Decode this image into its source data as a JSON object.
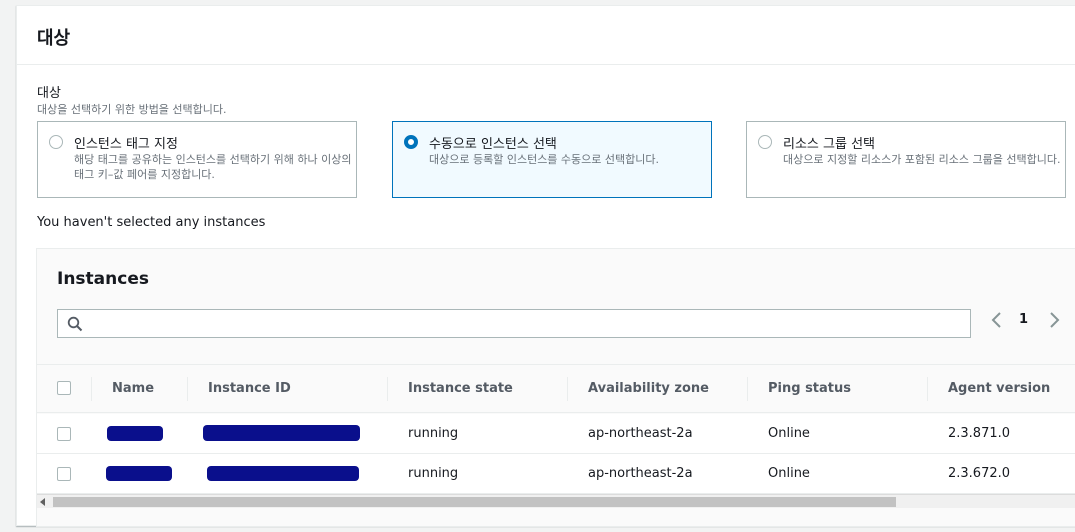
{
  "panel": {
    "title": "대상",
    "field_label": "대상",
    "field_description": "대상을 선택하기 위한 방법을 선택합니다."
  },
  "options": [
    {
      "title": "인스턴스 태그 지정",
      "description": "해당 태그를 공유하는 인스턴스를 선택하기 위해 하나 이상의 태그 키–값 페어를 지정합니다.",
      "selected": false
    },
    {
      "title": "수동으로 인스턴스 선택",
      "description": "대상으로 등록할 인스턴스를 수동으로 선택합니다.",
      "selected": true
    },
    {
      "title": "리소스 그룹 선택",
      "description": "대상으로 지정할 리소스가 포함된 리소스 그룹을 선택합니다.",
      "selected": false
    }
  ],
  "selection_message": "You haven't selected any instances",
  "instances": {
    "heading": "Instances",
    "search": {
      "value": "",
      "placeholder": ""
    },
    "pagination": {
      "current_page": "1"
    },
    "columns": [
      "Name",
      "Instance ID",
      "Instance state",
      "Availability zone",
      "Ping status",
      "Agent version"
    ],
    "rows": [
      {
        "state": "running",
        "zone": "ap-northeast-2a",
        "ping": "Online",
        "agent": "2.3.871.0"
      },
      {
        "state": "running",
        "zone": "ap-northeast-2a",
        "ping": "Online",
        "agent": "2.3.672.0"
      }
    ]
  },
  "colors": {
    "accent": "#0073bb",
    "selected_tile_bg": "#f1faff",
    "redaction": "#0a0f8c"
  },
  "icons": [
    "search-icon",
    "chevron-left-icon",
    "chevron-right-icon"
  ]
}
